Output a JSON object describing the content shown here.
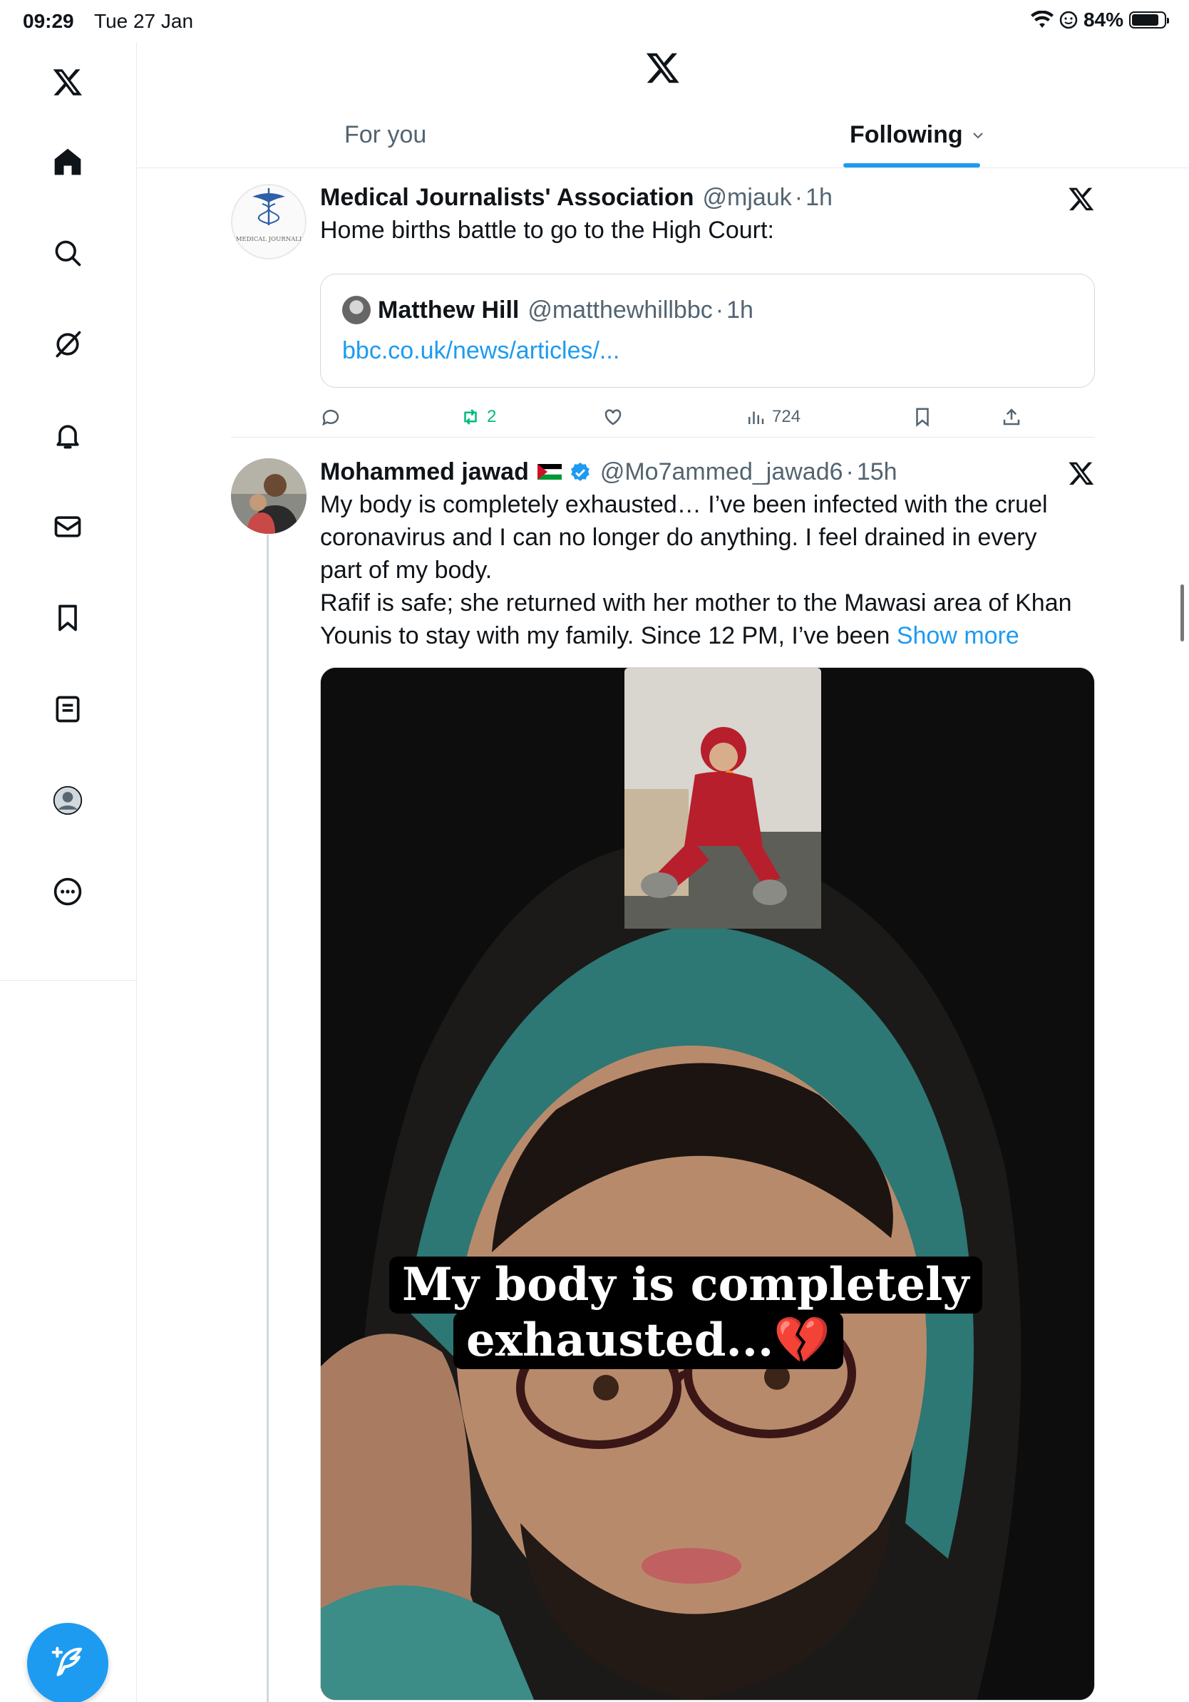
{
  "status_bar": {
    "time": "09:29",
    "date": "Tue 27 Jan",
    "battery": "84%",
    "battery_level": 0.84
  },
  "header": {
    "logo": "x-logo-icon",
    "tabs": [
      {
        "label": "For you",
        "active": false
      },
      {
        "label": "Following",
        "active": true
      }
    ]
  },
  "sidebar": {
    "items": [
      {
        "name": "x-logo-icon"
      },
      {
        "name": "home-icon"
      },
      {
        "name": "search-icon"
      },
      {
        "name": "grok-icon"
      },
      {
        "name": "notifications-icon"
      },
      {
        "name": "messages-icon"
      },
      {
        "name": "bookmarks-icon"
      },
      {
        "name": "lists-icon"
      },
      {
        "name": "profile-icon"
      },
      {
        "name": "more-icon"
      }
    ],
    "compose": "compose-icon"
  },
  "tweets": [
    {
      "name": "Medical Journalists' Association",
      "handle": "@mjauk",
      "time": "1h",
      "avatar_text": "MEDICAL JOURNALI",
      "text": "Home births battle to go to the High Court:",
      "quote": {
        "name": "Matthew Hill",
        "handle": "@matthewhillbbc",
        "time": "1h",
        "link": "bbc.co.uk/news/articles/..."
      },
      "actions": {
        "reply": "",
        "retweets": "2",
        "likes": "",
        "views": "724"
      }
    },
    {
      "name": "Mohammed jawad",
      "flag": "🇵🇸",
      "verified": true,
      "handle": "@Mo7ammed_jawad6",
      "time": "15h",
      "text": "My body is completely exhausted… I’ve been infected with the cruel coronavirus and I can no longer do anything. I feel drained in every part of my body.",
      "text2": "Rafif is safe; she returned with her mother to the Mawasi area of Khan Younis to stay with my family. Since 12 PM, I’ve been",
      "show_more": "Show more",
      "media_caption_line1": "My body is completely",
      "media_caption_line2": "exhausted...💔"
    }
  ],
  "colors": {
    "accent": "#1d9bf0",
    "text": "#0f1419",
    "muted": "#536471",
    "retweet": "#00ba7c",
    "border": "#cfd9de"
  }
}
